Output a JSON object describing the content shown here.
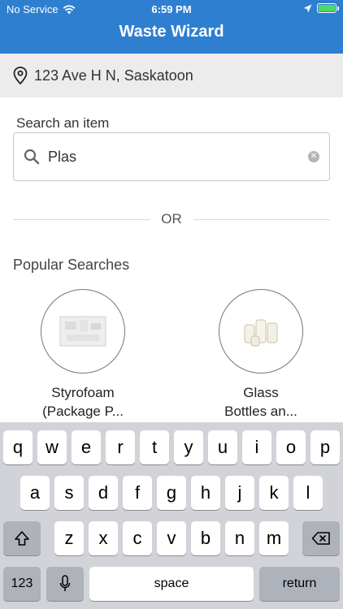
{
  "status_bar": {
    "carrier": "No Service",
    "time": "6:59 PM"
  },
  "header": {
    "title": "Waste Wizard"
  },
  "location": {
    "address": "123 Ave H  N, Saskatoon"
  },
  "search": {
    "label": "Search an item",
    "value": "Plas",
    "placeholder": ""
  },
  "divider": {
    "text": "OR"
  },
  "popular": {
    "title": "Popular Searches",
    "items": [
      {
        "line1": "Styrofoam",
        "line2": "(Package P..."
      },
      {
        "line1": "Glass",
        "line2": "Bottles an..."
      }
    ]
  },
  "keyboard": {
    "row1": [
      "q",
      "w",
      "e",
      "r",
      "t",
      "y",
      "u",
      "i",
      "o",
      "p"
    ],
    "row2": [
      "a",
      "s",
      "d",
      "f",
      "g",
      "h",
      "j",
      "k",
      "l"
    ],
    "row3": [
      "z",
      "x",
      "c",
      "v",
      "b",
      "n",
      "m"
    ],
    "numbers_label": "123",
    "space_label": "space",
    "return_label": "return"
  },
  "colors": {
    "header": "#2f7fd0",
    "location_bg": "#ececec",
    "keyboard_bg": "#d1d3d9"
  }
}
